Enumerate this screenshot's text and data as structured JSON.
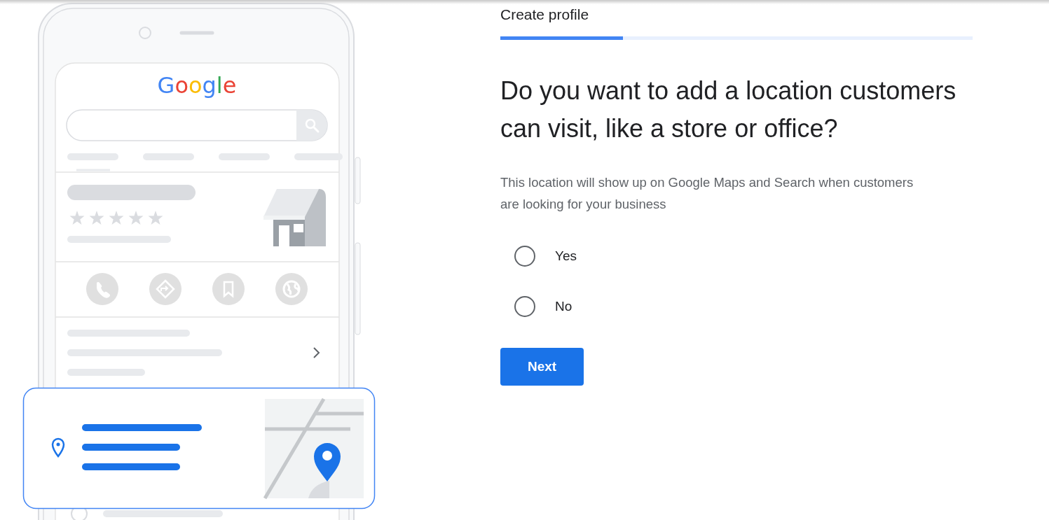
{
  "illustration": {
    "logo": "Google"
  },
  "step_title": "Create profile",
  "progress": {
    "level": 0.26
  },
  "question": "Do you want to add a location customers can visit, like a store or office?",
  "description": "This location will show up on Google Maps and Search when customers are looking for your business",
  "options": [
    {
      "label": "Yes",
      "selected": false
    },
    {
      "label": "No",
      "selected": false
    }
  ],
  "next_button": "Next"
}
